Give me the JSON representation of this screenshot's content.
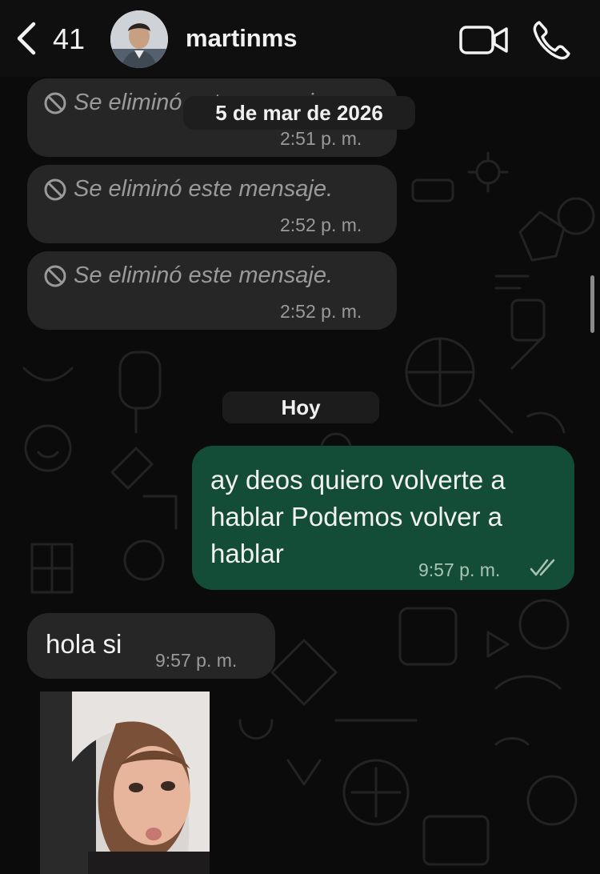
{
  "header": {
    "back_count": "41",
    "contact_name": "martinms"
  },
  "messages": [
    {
      "type": "deleted",
      "text": "Se eliminó este mensaje.",
      "time": "2:51 p. m."
    },
    {
      "type": "deleted",
      "text": "Se eliminó este mensaje.",
      "time": "2:52 p. m."
    },
    {
      "type": "deleted",
      "text": "Se eliminó este mensaje.",
      "time": "2:52 p. m."
    }
  ],
  "date_separator": "5 de mar de 2026",
  "today_separator": "Hoy",
  "outgoing": {
    "text": "ay deos quiero volverte a hablar Podemos volver a hablar",
    "time": "9:57 p. m.",
    "status_icon": "double-check-icon"
  },
  "incoming": {
    "text": "hola si",
    "time": "9:57 p. m."
  },
  "colors": {
    "outgoing_bubble": "#134d37",
    "incoming_bubble": "#262626",
    "background": "#0b0b0b"
  }
}
